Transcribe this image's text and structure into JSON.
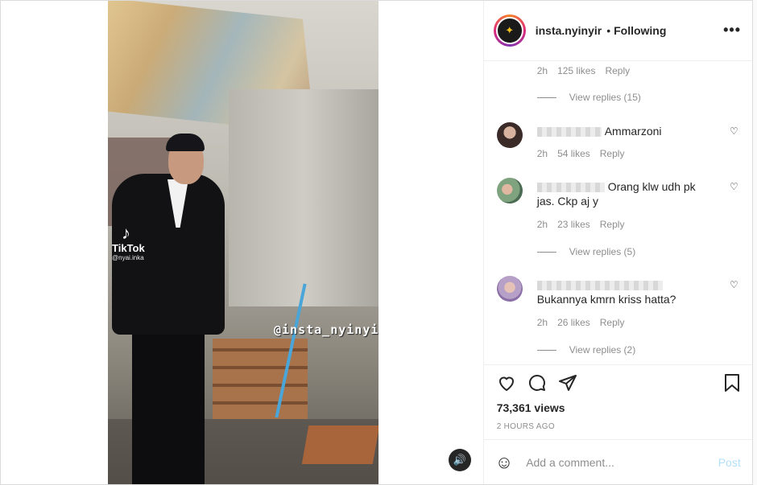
{
  "video": {
    "tiktok_label": "TikTok",
    "tiktok_user": "@nyai.inka",
    "watermark": "@insta_nyinyir",
    "sound_icon": "speaker-icon"
  },
  "header": {
    "username": "insta.nyinyir",
    "separator": "•",
    "follow_status": "Following",
    "more_icon": "•••"
  },
  "comments": {
    "top_partial": {
      "time": "2h",
      "likes": "125 likes",
      "reply": "Reply",
      "view_replies": "View replies (15)"
    },
    "items": [
      {
        "text": "Ammarzoni",
        "time": "2h",
        "likes": "54 likes",
        "reply": "Reply"
      },
      {
        "text": "Orang klw udh pk jas. Ckp aj y",
        "time": "2h",
        "likes": "23 likes",
        "reply": "Reply",
        "view_replies": "View replies (5)"
      },
      {
        "text": "Bukannya kmrn kriss hatta?",
        "time": "2h",
        "likes": "26 likes",
        "reply": "Reply",
        "view_replies": "View replies (2)"
      }
    ]
  },
  "actions": {
    "views": "73,361 views",
    "time_ago": "2 HOURS AGO"
  },
  "add_comment": {
    "placeholder": "Add a comment...",
    "post_label": "Post"
  },
  "colors": {
    "text": "#262626",
    "secondary": "#8e8e8e",
    "post_disabled": "#b2dffc",
    "border": "#efefef"
  }
}
